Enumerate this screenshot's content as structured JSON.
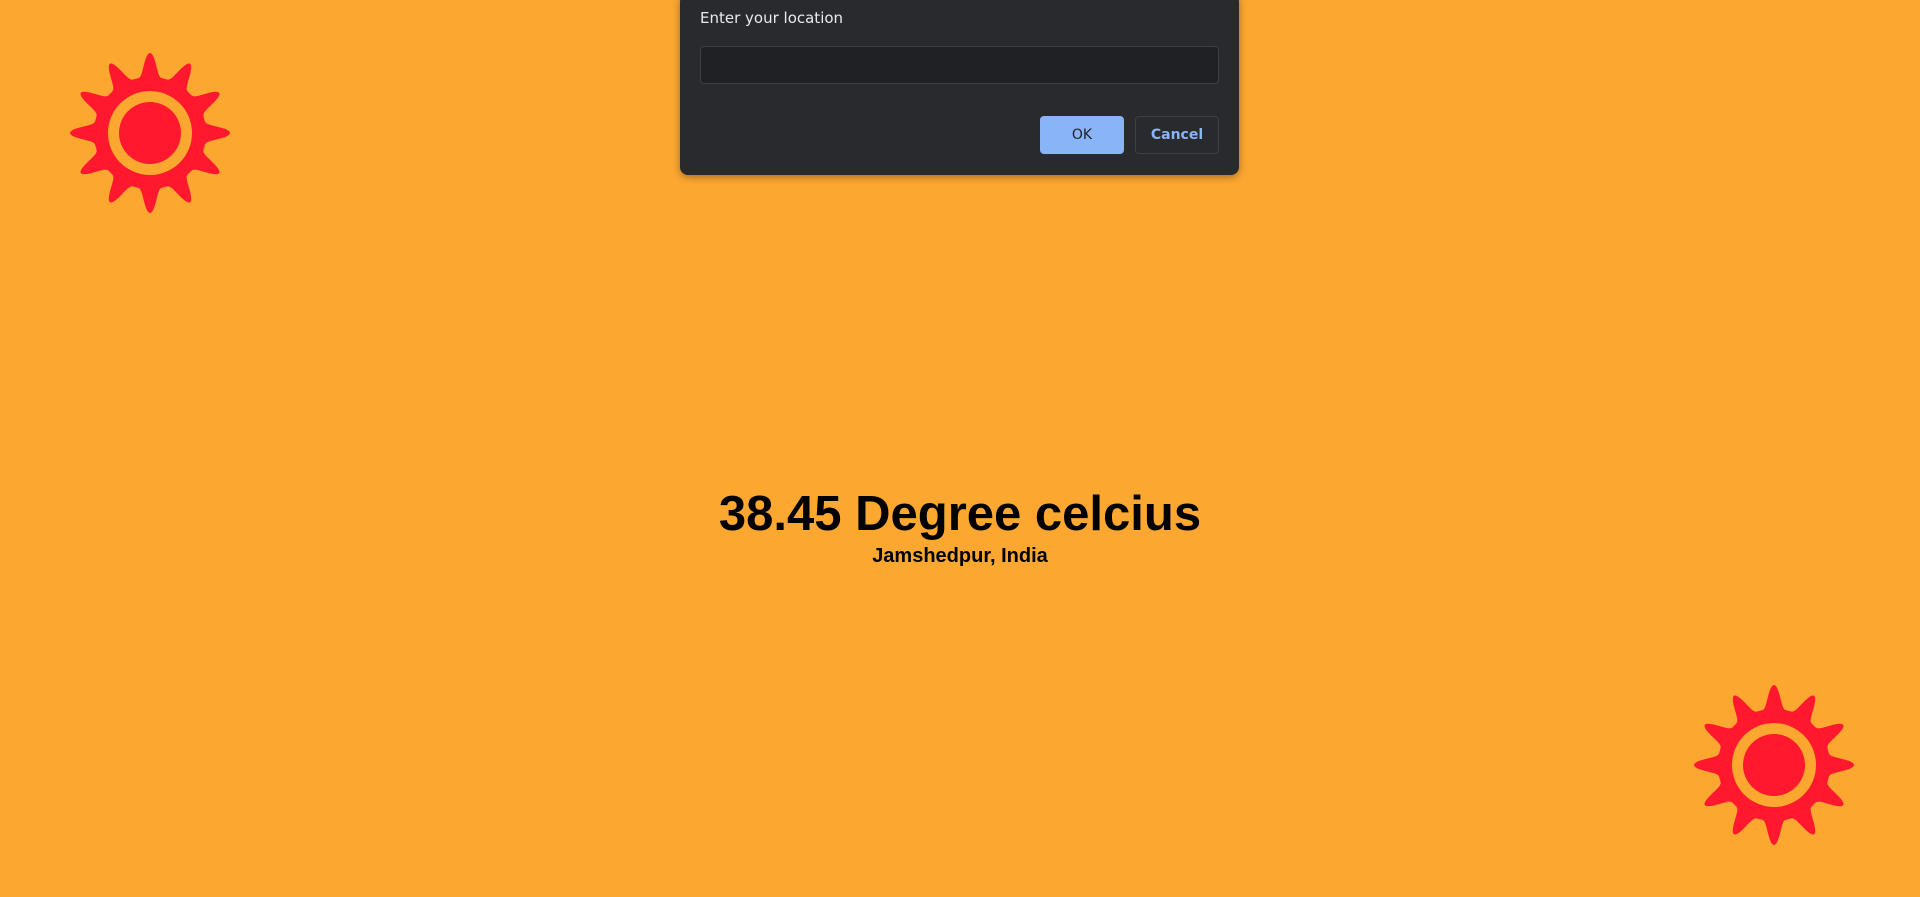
{
  "colors": {
    "background": "#FBA730",
    "sun": "#FF182E",
    "dialog_bg": "#292A2D",
    "dialog_accent": "#8AB4F8"
  },
  "icons": {
    "top_left": "sun-icon",
    "bottom_right": "sun-icon"
  },
  "weather": {
    "temperature": "38.45 Degree celcius",
    "location": "Jamshedpur, India"
  },
  "dialog": {
    "message": "Enter your location",
    "input_value": "",
    "ok_label": "OK",
    "cancel_label": "Cancel"
  }
}
